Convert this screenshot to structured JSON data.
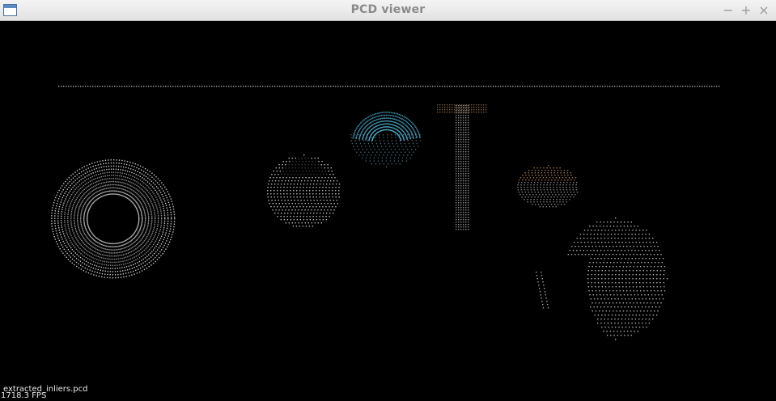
{
  "window": {
    "title": "PCD viewer",
    "minimize_label": "−",
    "maximize_label": "+",
    "close_label": "×"
  },
  "viewport": {
    "background": "#000000",
    "point_colors": {
      "white": "#e8e8e8",
      "cyan": "#4fb8d8",
      "warm": "#d8a070"
    },
    "cloud_name": "extracted_inliers.pcd",
    "fps": "1718.3 FPS"
  },
  "icons": {
    "app": "window-app-icon"
  }
}
